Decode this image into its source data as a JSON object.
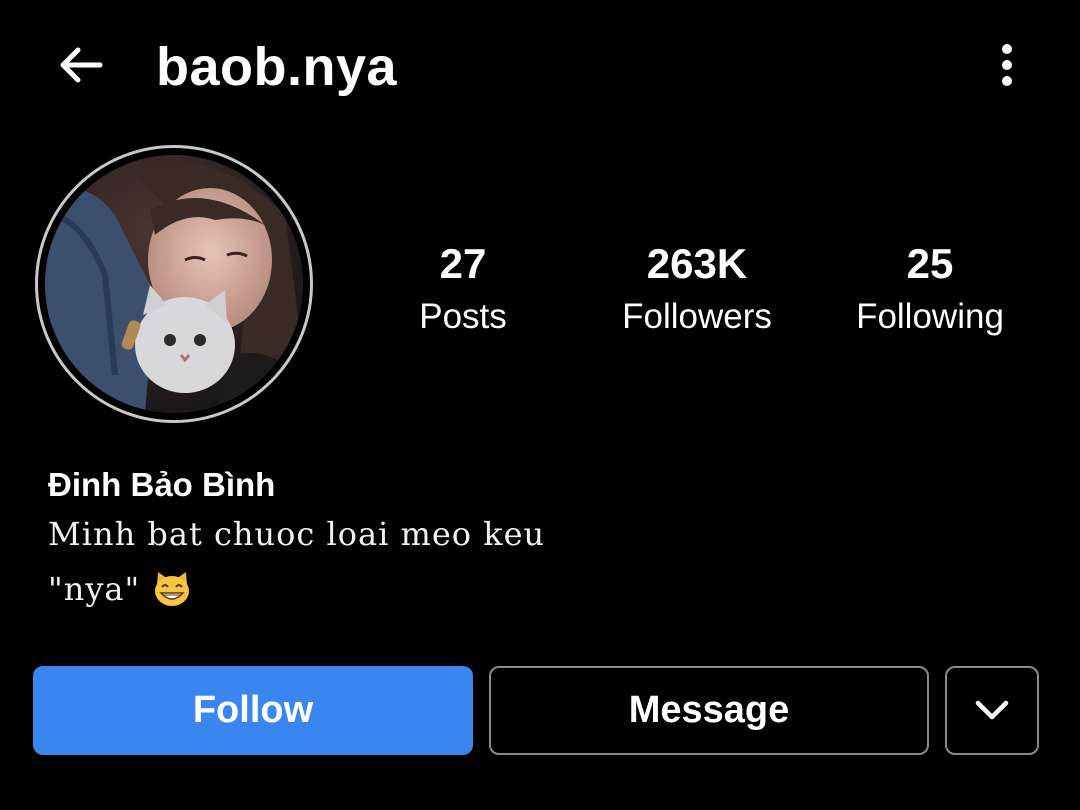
{
  "header": {
    "username": "baob.nya",
    "back_icon": "arrow-left-icon",
    "more_icon": "more-vertical-icon"
  },
  "profile": {
    "avatar_icon": "profile-photo",
    "stats": {
      "posts": {
        "value": "27",
        "label": "Posts"
      },
      "followers": {
        "value": "263K",
        "label": "Followers"
      },
      "following": {
        "value": "25",
        "label": "Following"
      }
    },
    "display_name": "Đinh Bảo Bình",
    "bio": {
      "line1": "Minh bat chuoc loai meo keu",
      "line2": "\"nya\"",
      "emoji": "grinning-cat-emoji"
    }
  },
  "actions": {
    "follow_label": "Follow",
    "message_label": "Message",
    "dropdown_icon": "chevron-down-icon"
  },
  "colors": {
    "background": "#000000",
    "text": "#ffffff",
    "follow_button": "#3a86f0",
    "outline_button_border": "#8a8a8a",
    "avatar_ring": "#c8c8c8"
  }
}
